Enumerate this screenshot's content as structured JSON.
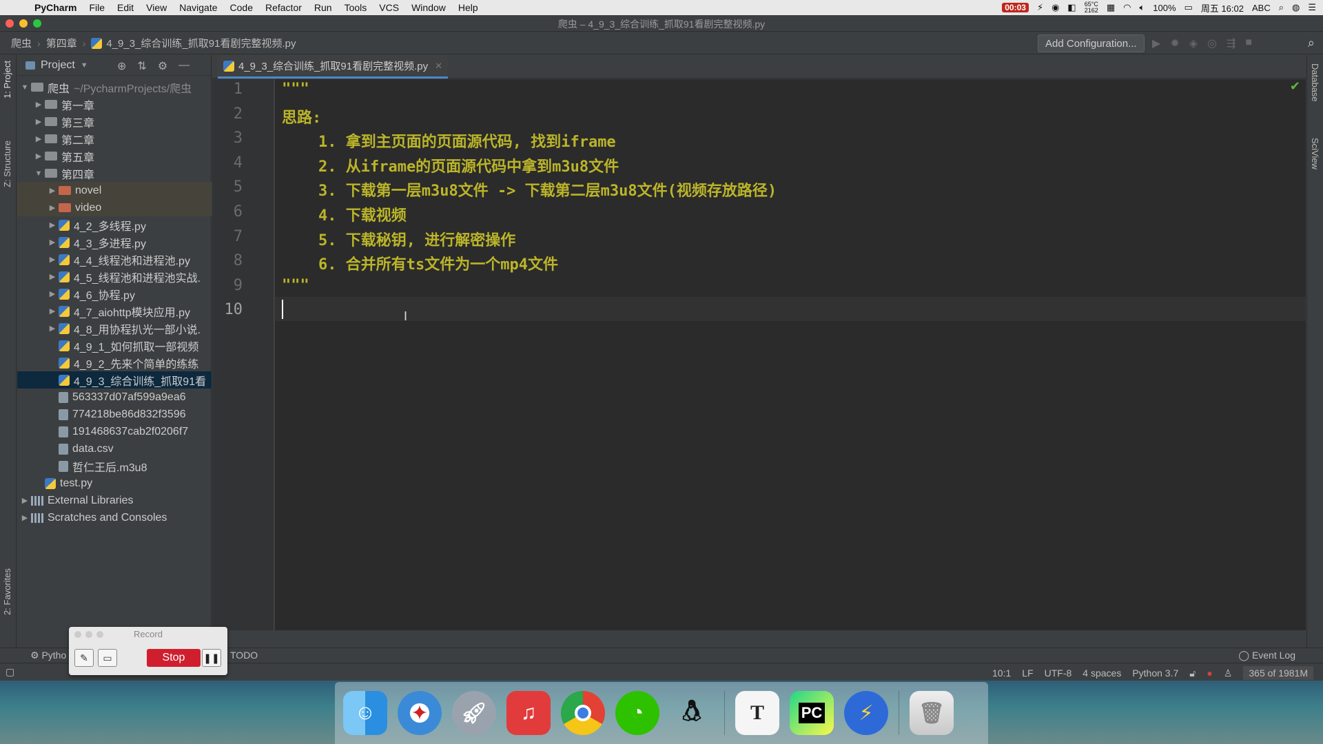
{
  "menubar": {
    "app_name": "PyCharm",
    "items": [
      "File",
      "Edit",
      "View",
      "Navigate",
      "Code",
      "Refactor",
      "Run",
      "Tools",
      "VCS",
      "Window",
      "Help"
    ],
    "record_time": "00:03",
    "weather_temp": "65°C",
    "weather_val": "2162",
    "battery": "100%",
    "clock": "周五 16:02",
    "input_method": "ABC"
  },
  "titlebar": {
    "title": "爬虫 – 4_9_3_综合训练_抓取91看剧完整视频.py"
  },
  "navbar": {
    "crumbs": [
      "爬虫",
      "第四章",
      "4_9_3_综合训练_抓取91看剧完整视频.py"
    ],
    "add_config": "Add Configuration..."
  },
  "sidebar_tabs": {
    "project": "1: Project",
    "structure": "Z: Structure",
    "favorites": "2: Favorites"
  },
  "right_tabs": {
    "database": "Database",
    "sciview": "SciView"
  },
  "project_panel": {
    "title": "Project",
    "root_name": "爬虫",
    "root_path": "~/PycharmProjects/爬虫",
    "items": [
      {
        "label": "第一章",
        "kind": "folder",
        "depth": 1,
        "arrow": "▶"
      },
      {
        "label": "第三章",
        "kind": "folder",
        "depth": 1,
        "arrow": "▶"
      },
      {
        "label": "第二章",
        "kind": "folder",
        "depth": 1,
        "arrow": "▶"
      },
      {
        "label": "第五章",
        "kind": "folder",
        "depth": 1,
        "arrow": "▶"
      },
      {
        "label": "第四章",
        "kind": "folder",
        "depth": 1,
        "arrow": "▼"
      },
      {
        "label": "novel",
        "kind": "folder-red",
        "depth": 2,
        "arrow": "▶"
      },
      {
        "label": "video",
        "kind": "folder-red",
        "depth": 2,
        "arrow": "▶"
      },
      {
        "label": "4_2_多线程.py",
        "kind": "py",
        "depth": 2,
        "arrow": "▶"
      },
      {
        "label": "4_3_多进程.py",
        "kind": "py",
        "depth": 2,
        "arrow": "▶"
      },
      {
        "label": "4_4_线程池和进程池.py",
        "kind": "py",
        "depth": 2,
        "arrow": "▶"
      },
      {
        "label": "4_5_线程池和进程池实战.",
        "kind": "py",
        "depth": 2,
        "arrow": "▶"
      },
      {
        "label": "4_6_协程.py",
        "kind": "py",
        "depth": 2,
        "arrow": "▶"
      },
      {
        "label": "4_7_aiohttp模块应用.py",
        "kind": "py",
        "depth": 2,
        "arrow": "▶"
      },
      {
        "label": "4_8_用协程扒光一部小说.",
        "kind": "py",
        "depth": 2,
        "arrow": "▶"
      },
      {
        "label": "4_9_1_如何抓取一部视频",
        "kind": "py",
        "depth": 2,
        "arrow": ""
      },
      {
        "label": "4_9_2_先来个简单的练练",
        "kind": "py",
        "depth": 2,
        "arrow": ""
      },
      {
        "label": "4_9_3_综合训练_抓取91看",
        "kind": "py",
        "depth": 2,
        "arrow": "",
        "selected": true
      },
      {
        "label": "563337d07af599a9ea6",
        "kind": "file",
        "depth": 2,
        "arrow": ""
      },
      {
        "label": "774218be86d832f3596",
        "kind": "file",
        "depth": 2,
        "arrow": ""
      },
      {
        "label": "191468637cab2f0206f7",
        "kind": "file",
        "depth": 2,
        "arrow": ""
      },
      {
        "label": "data.csv",
        "kind": "file",
        "depth": 2,
        "arrow": ""
      },
      {
        "label": "哲仁王后.m3u8",
        "kind": "file",
        "depth": 2,
        "arrow": ""
      },
      {
        "label": "test.py",
        "kind": "py",
        "depth": 1,
        "arrow": ""
      },
      {
        "label": "External Libraries",
        "kind": "lib",
        "depth": 0,
        "arrow": "▶"
      },
      {
        "label": "Scratches and Consoles",
        "kind": "lib",
        "depth": 0,
        "arrow": "▶"
      }
    ]
  },
  "editor": {
    "tab_label": "4_9_3_综合训练_抓取91看剧完整视频.py",
    "lines": [
      "\"\"\"",
      "思路:",
      "    1. 拿到主页面的页面源代码, 找到iframe",
      "    2. 从iframe的页面源代码中拿到m3u8文件",
      "    3. 下载第一层m3u8文件 -> 下载第二层m3u8文件(视频存放路径)",
      "    4. 下载视频",
      "    5. 下载秘钥, 进行解密操作",
      "    6. 合并所有ts文件为一个mp4文件",
      "\"\"\"",
      ""
    ],
    "line_numbers": [
      "1",
      "2",
      "3",
      "4",
      "5",
      "6",
      "7",
      "8",
      "9",
      "10"
    ]
  },
  "bottom_tools": {
    "python_console": "Pytho",
    "todo": "TODO",
    "event_log": "Event Log"
  },
  "statusbar": {
    "position": "10:1",
    "line_sep": "LF",
    "encoding": "UTF-8",
    "indent": "4 spaces",
    "interpreter": "Python 3.7",
    "memory": "365 of 1981M"
  },
  "record_widget": {
    "title": "Record",
    "stop_label": "Stop"
  },
  "dock": {
    "apps": [
      "finder-icon",
      "safari-icon",
      "launchpad-icon",
      "netease-music-icon",
      "chrome-icon",
      "wechat-icon",
      "qq-icon",
      "typora-icon",
      "pycharm-icon",
      "thunder-icon",
      "trash-icon"
    ],
    "typora_letter": "T",
    "pycharm_letters": "PC"
  }
}
